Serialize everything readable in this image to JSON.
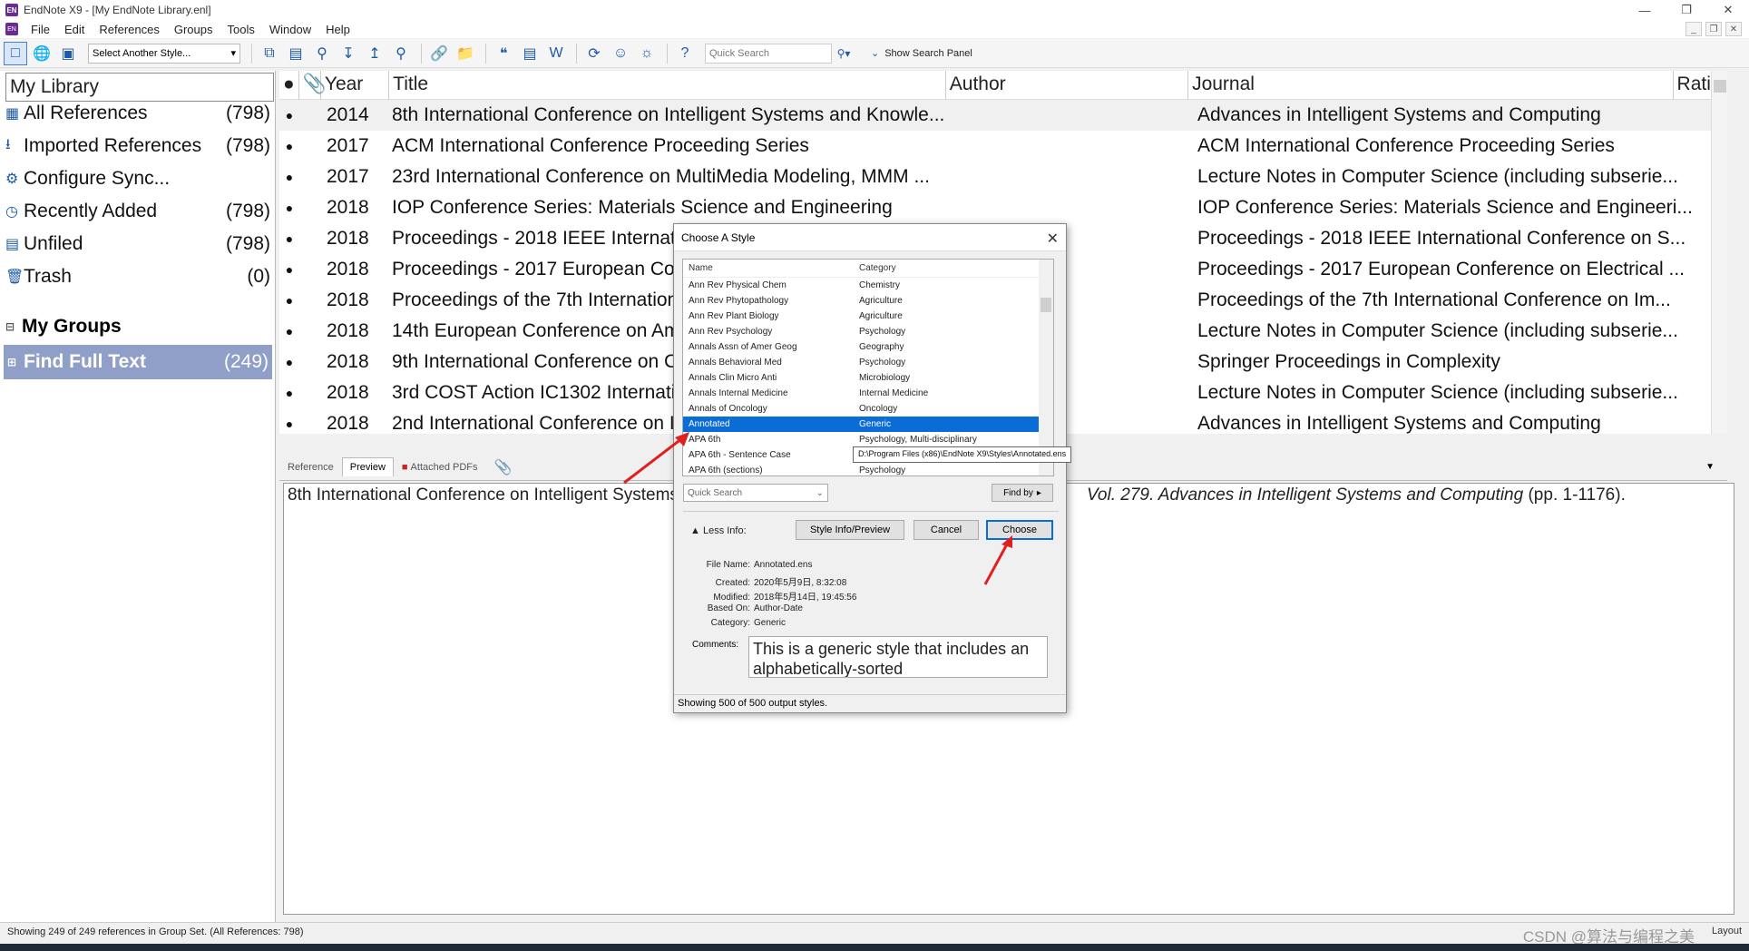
{
  "window": {
    "title": "EndNote X9 - [My EndNote Library.enl]",
    "app_icon": "EN"
  },
  "menu": [
    "File",
    "Edit",
    "References",
    "Groups",
    "Tools",
    "Window",
    "Help"
  ],
  "toolbar": {
    "style_select": "Select Another Style...",
    "quick_search_placeholder": "Quick Search",
    "show_search_panel": "Show Search Panel"
  },
  "library": {
    "header": "My Library",
    "groups": [
      {
        "label": "All References",
        "count": "(798)",
        "icon": "all-references-icon"
      },
      {
        "label": "Imported References",
        "count": "(798)",
        "icon": "imported-references-icon"
      },
      {
        "label": "Configure Sync...",
        "count": "",
        "icon": "sync-icon"
      },
      {
        "label": "Recently Added",
        "count": "(798)",
        "icon": "clock-icon"
      },
      {
        "label": "Unfiled",
        "count": "(798)",
        "icon": "unfiled-icon"
      },
      {
        "label": "Trash",
        "count": "(0)",
        "icon": "trash-icon"
      }
    ],
    "my_groups": "My Groups",
    "find_full_text": {
      "label": "Find Full Text",
      "count": "(249)"
    }
  },
  "references": {
    "columns": {
      "year": "Year",
      "title": "Title",
      "author": "Author",
      "journal": "Journal",
      "rating": "Ratir"
    },
    "rows": [
      {
        "year": "2014",
        "title": "8th International Conference on Intelligent Systems and Knowle...",
        "journal": "Advances in Intelligent Systems and Computing"
      },
      {
        "year": "2017",
        "title": "ACM International Conference Proceeding Series",
        "journal": "ACM International Conference Proceeding Series"
      },
      {
        "year": "2017",
        "title": "23rd International Conference on MultiMedia Modeling, MMM ...",
        "journal": "Lecture Notes in Computer Science (including subserie..."
      },
      {
        "year": "2018",
        "title": "IOP Conference Series: Materials Science and Engineering",
        "journal": "IOP Conference Series: Materials Science and Engineeri..."
      },
      {
        "year": "2018",
        "title": "Proceedings - 2018 IEEE Internatio",
        "journal": "Proceedings - 2018 IEEE International Conference on S..."
      },
      {
        "year": "2018",
        "title": "Proceedings - 2017 European Con",
        "journal": "Proceedings - 2017 European Conference on Electrical ..."
      },
      {
        "year": "2018",
        "title": "Proceedings of the 7th Internation",
        "journal": "Proceedings of the 7th International Conference on Im..."
      },
      {
        "year": "2018",
        "title": "14th European Conference on Am",
        "journal": "Lecture Notes in Computer Science (including subserie..."
      },
      {
        "year": "2018",
        "title": "9th International Conference on C",
        "journal": "Springer Proceedings in Complexity"
      },
      {
        "year": "2018",
        "title": "3rd COST Action IC1302 Internatio",
        "journal": "Lecture Notes in Computer Science (including subserie..."
      },
      {
        "year": "2018",
        "title": "2nd International Conference on I",
        "journal": "Advances in Intelligent Systems and Computing"
      }
    ]
  },
  "tabs": [
    "Reference",
    "Preview",
    "Attached PDFs"
  ],
  "preview": {
    "text_start": "8th International Conference on Intelligent Systems",
    "text_italic": "Vol. 279. Advances in Intelligent Systems and Computing",
    "text_end": " (pp. 1-1176)."
  },
  "status": "Showing 249 of 249 references in Group Set. (All References: 798)",
  "watermark": "CSDN @算法与编程之美",
  "layout_label": "Layout",
  "dialog": {
    "title": "Choose A Style",
    "columns": {
      "name": "Name",
      "category": "Category"
    },
    "styles": [
      {
        "name": "Ann Rev Physical Chem",
        "category": "Chemistry"
      },
      {
        "name": "Ann Rev Phytopathology",
        "category": "Agriculture"
      },
      {
        "name": "Ann Rev Plant Biology",
        "category": "Agriculture"
      },
      {
        "name": "Ann Rev Psychology",
        "category": "Psychology"
      },
      {
        "name": "Annals Assn of Amer Geog",
        "category": "Geography"
      },
      {
        "name": "Annals Behavioral Med",
        "category": "Psychology"
      },
      {
        "name": "Annals Clin Micro Anti",
        "category": "Microbiology"
      },
      {
        "name": "Annals Internal Medicine",
        "category": "Internal Medicine"
      },
      {
        "name": "Annals of Oncology",
        "category": "Oncology"
      },
      {
        "name": "Annotated",
        "category": "Generic"
      },
      {
        "name": "APA 6th",
        "category": "Psychology, Multi-disciplinary"
      },
      {
        "name": "APA 6th - Sentence Case",
        "category": ""
      },
      {
        "name": "APA 6th (sections)",
        "category": "Psychology"
      }
    ],
    "tooltip": "D:\\Program Files (x86)\\EndNote X9\\Styles\\Annotated.ens",
    "quick_search": "Quick Search",
    "find_by": "Find by",
    "less_info": "Less Info:",
    "style_info_button": "Style Info/Preview",
    "cancel_button": "Cancel",
    "choose_button": "Choose",
    "info": {
      "file_name_label": "File Name:",
      "file_name": "Annotated.ens",
      "created_label": "Created:",
      "created": "2020年5月9日, 8:32:08",
      "modified_label": "Modified:",
      "modified": "2018年5月14日, 19:45:56",
      "based_on_label": "Based On:",
      "based_on": "Author-Date",
      "category_label": "Category:",
      "category": "Generic",
      "comments_label": "Comments:",
      "comments": "This is a generic style that includes an alphabetically-sorted"
    },
    "status": "Showing 500 of 500 output styles."
  },
  "colors": {
    "selection": "#0a6cd6",
    "group_highlight": "#8f9fc8",
    "annotation_arrow": "#e02020"
  }
}
